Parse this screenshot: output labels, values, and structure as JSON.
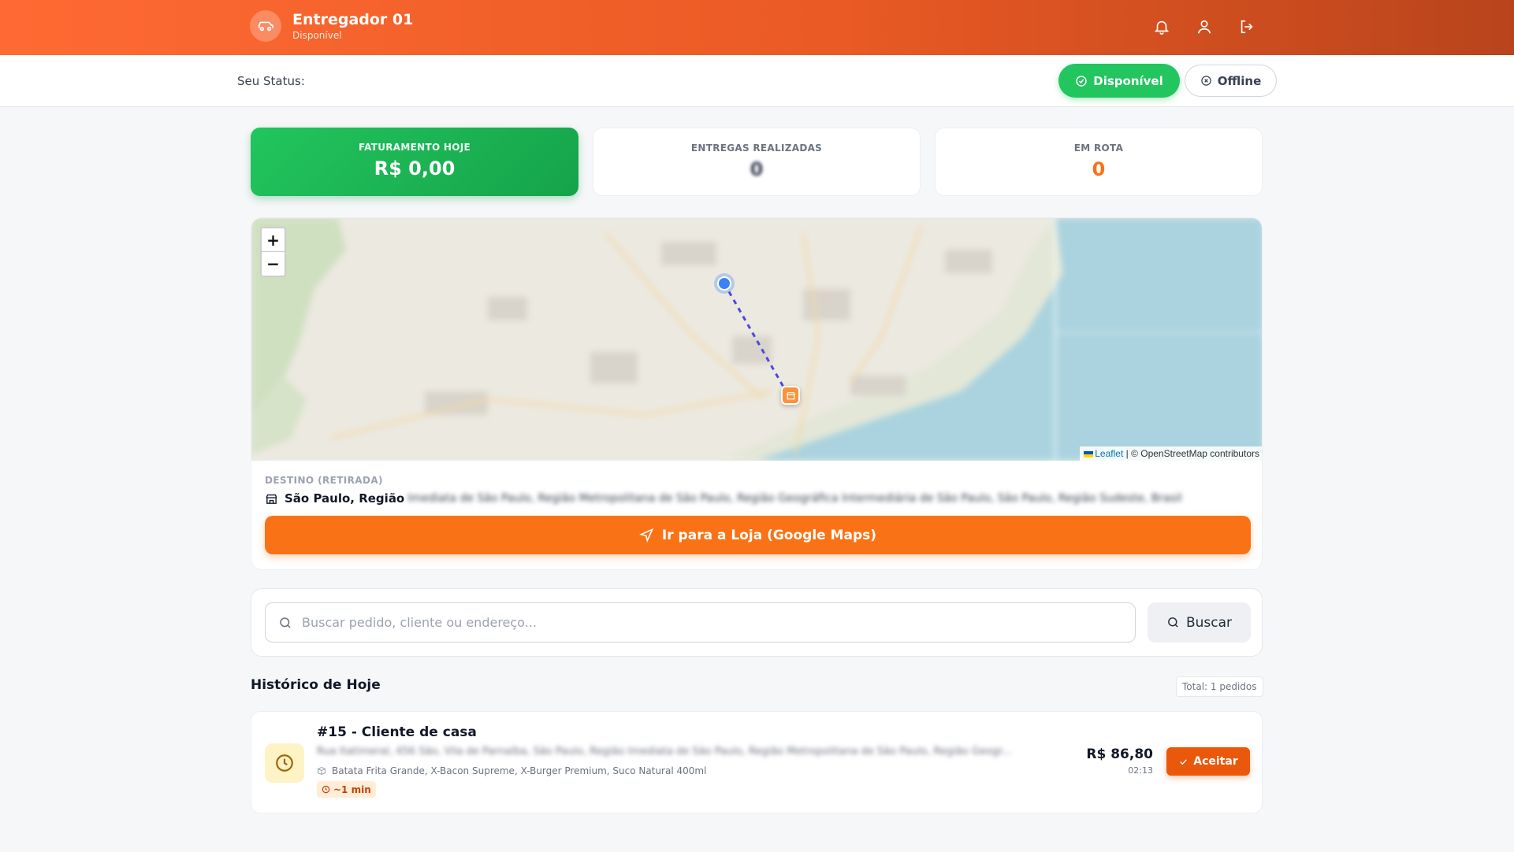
{
  "header": {
    "title": "Entregador 01",
    "subtitle": "Disponível"
  },
  "status": {
    "label": "Seu Status:",
    "available_label": "Disponível",
    "offline_label": "Offline"
  },
  "stats": [
    {
      "label": "FATURAMENTO HOJE",
      "value": "R$ 0,00"
    },
    {
      "label": "ENTREGAS REALIZADAS",
      "value": "0"
    },
    {
      "label": "EM ROTA",
      "value": "0"
    }
  ],
  "map": {
    "zoom_in": "+",
    "zoom_out": "−",
    "attribution_link": "Leaflet",
    "attribution_text": " | © OpenStreetMap contributors"
  },
  "destination": {
    "label": "DESTINO (RETIRADA)",
    "address_visible": "São Paulo, Região",
    "address_blurred": "Imediata de São Paulo, Região Metropolitana de São Paulo, Região Geográfica Intermediária de São Paulo, São Paulo, Região Sudeste, Brasil",
    "go_button": "Ir para a Loja (Google Maps)"
  },
  "search": {
    "placeholder": "Buscar pedido, cliente ou endereço...",
    "button": "Buscar"
  },
  "history": {
    "title": "Histórico de Hoje",
    "total": "Total: 1 pedidos",
    "orders": [
      {
        "title": "#15 - Cliente de casa",
        "address": "Rua Itatimeral, 456 São, Vila de Parnaíba, São Paulo, Região Imediata de São Paulo, Região Metropolitana de São Paulo, Região Geogr...",
        "items": "Batata Frita Grande, X-Bacon Supreme, X-Burger Premium, Suco Natural 400ml",
        "eta": "~1 min",
        "price": "R$ 86,80",
        "time": "02:13",
        "accept": "Aceitar"
      }
    ]
  },
  "colors": {
    "brand_orange": "#f97316",
    "header_start": "#ff6a33",
    "header_end": "#b9441c",
    "success_green": "#22c55e"
  }
}
